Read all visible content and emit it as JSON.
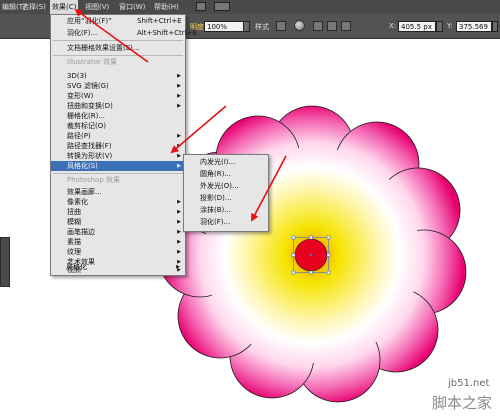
{
  "menubar": {
    "items": [
      {
        "label": "编辑(T)"
      },
      {
        "label": "选择(S)"
      },
      {
        "label": "效果(C)"
      },
      {
        "label": "视图(V)"
      },
      {
        "label": "窗口(W)"
      },
      {
        "label": "帮助(H)"
      }
    ]
  },
  "options_bar": {
    "opacity_value": "100%",
    "style_label": "样式",
    "x_label": "X:",
    "x_value": "405.5 px",
    "y_label": "Y:",
    "y_value": "375.569"
  },
  "effects_menu": {
    "top_items": [
      {
        "label": "应用“羽化(F)”",
        "shortcut": "Shift+Ctrl+E"
      },
      {
        "label": "羽化(F)...",
        "shortcut": "Alt+Shift+Ctrl+E"
      }
    ],
    "doc_raster": "文档栅格效果设置(E)...",
    "illustrator_header": "Illustrator 效果",
    "illustrator_items": [
      {
        "label": "3D(3)",
        "arrow": "▶"
      },
      {
        "label": "SVG 滤镜(G)",
        "arrow": "▶"
      },
      {
        "label": "变形(W)",
        "arrow": "▶"
      },
      {
        "label": "扭曲和变换(D)",
        "arrow": "▶"
      },
      {
        "label": "栅格化(R)...",
        "arrow": ""
      },
      {
        "label": "裁剪标记(O)",
        "arrow": ""
      },
      {
        "label": "路径(P)",
        "arrow": "▶"
      },
      {
        "label": "路径查找器(F)",
        "arrow": "▶"
      },
      {
        "label": "转换为形状(V)",
        "arrow": "▶"
      },
      {
        "label": "风格化(S)",
        "arrow": "▶"
      }
    ],
    "photoshop_header": "Photoshop 效果",
    "photoshop_items": [
      {
        "label": "效果画廊...",
        "arrow": ""
      },
      {
        "label": "像素化",
        "arrow": "▶"
      },
      {
        "label": "扭曲",
        "arrow": "▶"
      },
      {
        "label": "模糊",
        "arrow": "▶"
      },
      {
        "label": "画笔描边",
        "arrow": "▶"
      },
      {
        "label": "素描",
        "arrow": "▶"
      },
      {
        "label": "纹理",
        "arrow": "▶"
      },
      {
        "label": "艺术效果",
        "arrow": "▶"
      },
      {
        "label": "视频",
        "arrow": "▶"
      },
      {
        "label": "风格化",
        "arrow": "▶"
      }
    ]
  },
  "stylize_submenu": {
    "items": [
      {
        "label": "内发光(I)..."
      },
      {
        "label": "圆角(R)..."
      },
      {
        "label": "外发光(O)..."
      },
      {
        "label": "投影(D)..."
      },
      {
        "label": "涂抹(B)..."
      },
      {
        "label": "羽化(F)..."
      }
    ]
  },
  "artwork": {
    "petal_edge_color": "#e8006e",
    "center_color": "#f5e400",
    "small_circle_color": "#e8001e",
    "arrow_color": "#e81010"
  },
  "watermark": {
    "site": "jb51.net",
    "name": "脚本之家"
  }
}
